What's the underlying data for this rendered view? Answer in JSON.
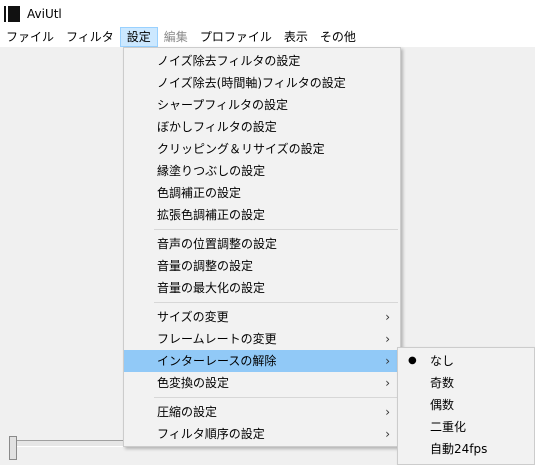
{
  "window": {
    "title": "AviUtl"
  },
  "menubar": [
    {
      "label": "ファイル",
      "state": "normal"
    },
    {
      "label": "フィルタ",
      "state": "normal"
    },
    {
      "label": "設定",
      "state": "active"
    },
    {
      "label": "編集",
      "state": "disabled"
    },
    {
      "label": "プロファイル",
      "state": "normal"
    },
    {
      "label": "表示",
      "state": "normal"
    },
    {
      "label": "その他",
      "state": "normal"
    }
  ],
  "settings_menu": {
    "group1": [
      "ノイズ除去フィルタの設定",
      "ノイズ除去(時間軸)フィルタの設定",
      "シャープフィルタの設定",
      "ぼかしフィルタの設定",
      "クリッピング＆リサイズの設定",
      "縁塗りつぶしの設定",
      "色調補正の設定",
      "拡張色調補正の設定"
    ],
    "group2": [
      "音声の位置調整の設定",
      "音量の調整の設定",
      "音量の最大化の設定"
    ],
    "group3": [
      {
        "label": "サイズの変更",
        "submenu": true
      },
      {
        "label": "フレームレートの変更",
        "submenu": true
      },
      {
        "label": "インターレースの解除",
        "submenu": true,
        "highlighted": true
      },
      {
        "label": "色変換の設定",
        "submenu": true
      }
    ],
    "group4": [
      {
        "label": "圧縮の設定",
        "submenu": true
      },
      {
        "label": "フィルタ順序の設定",
        "submenu": true
      }
    ],
    "arrow_glyph": "›"
  },
  "deinterlace_submenu": {
    "items": [
      {
        "label": "なし",
        "checked": true
      },
      {
        "label": "奇数",
        "checked": false
      },
      {
        "label": "偶数",
        "checked": false
      },
      {
        "label": "二重化",
        "checked": false
      },
      {
        "label": "自動24fps",
        "checked": false
      }
    ],
    "bullet_glyph": "●"
  },
  "colors": {
    "menu_highlight": "#91c9f7",
    "menubar_active": "#cce8ff",
    "menu_background": "#f2f2f2"
  }
}
